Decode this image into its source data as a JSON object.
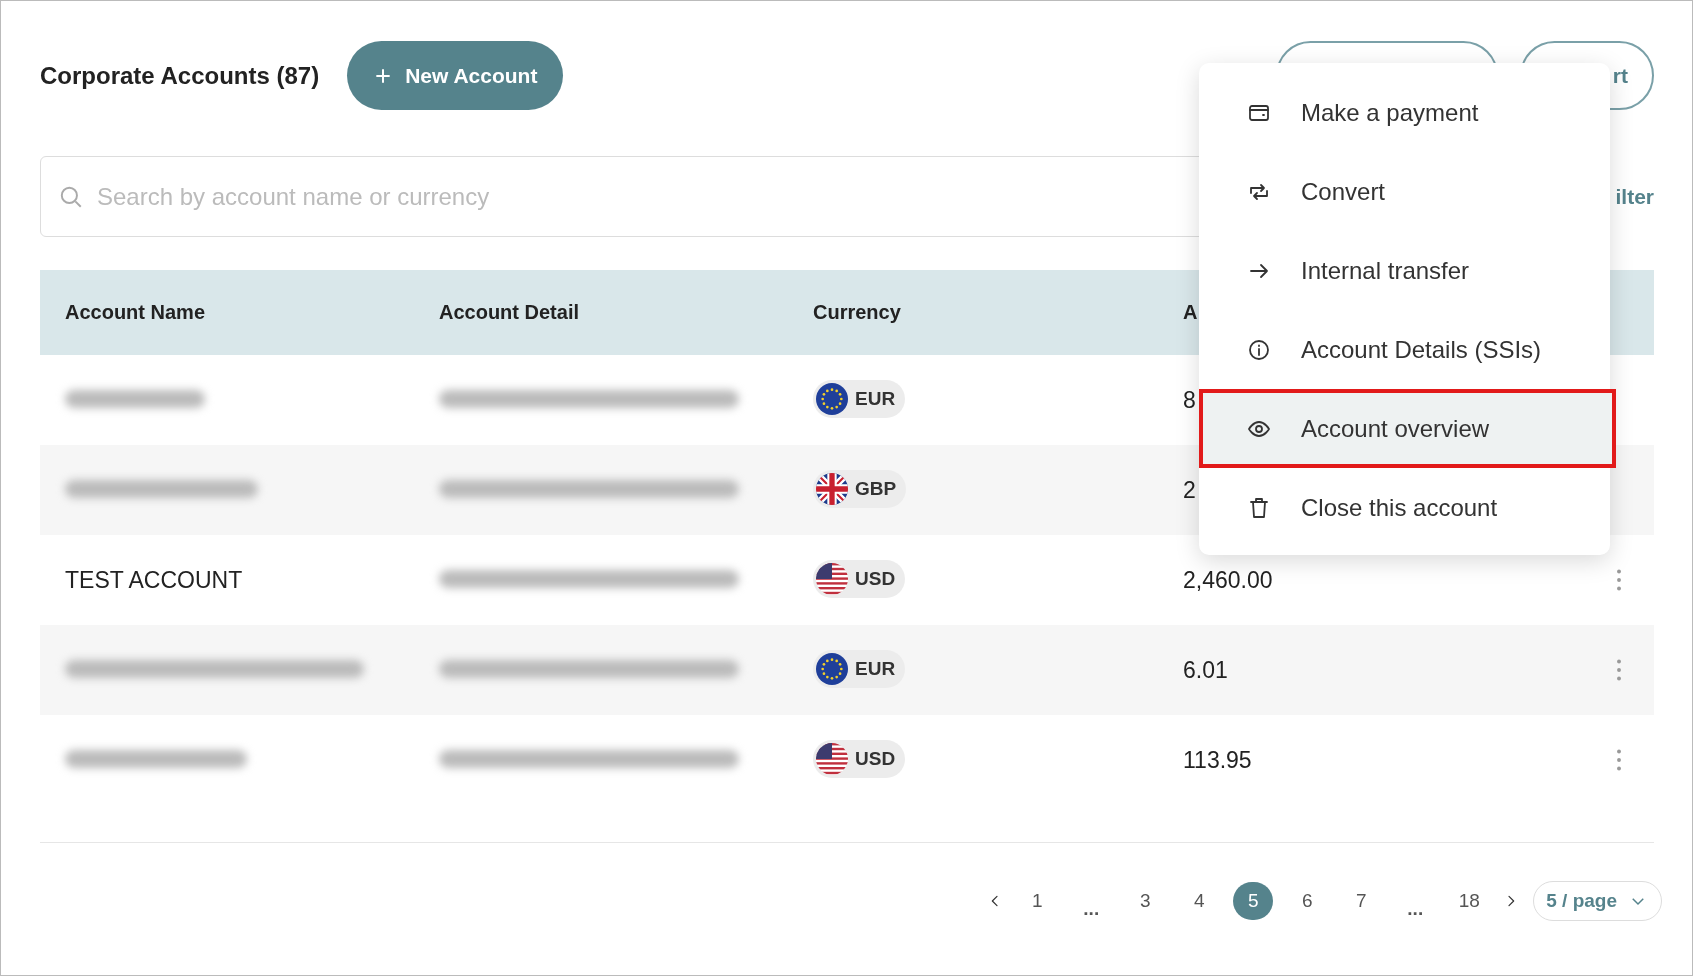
{
  "header": {
    "title": "Corporate Accounts (87)",
    "new_button": "New Account",
    "buttons": [
      {
        "kind": "blank"
      },
      {
        "kind": "text",
        "label": "rt"
      }
    ]
  },
  "search": {
    "placeholder": "Search by account name or currency",
    "filter_label": "ilter"
  },
  "table": {
    "columns": [
      "Account Name",
      "Account Detail",
      "Currency",
      "A"
    ],
    "rows": [
      {
        "name": {
          "redacted": true
        },
        "detail": {
          "redacted": true
        },
        "currency": {
          "kind": "eu",
          "code": "EUR"
        },
        "amount": "8",
        "actions": false
      },
      {
        "name": {
          "redacted": true
        },
        "detail": {
          "redacted": true
        },
        "currency": {
          "kind": "gb",
          "code": "GBP"
        },
        "amount": "2",
        "actions": false
      },
      {
        "name": {
          "redacted": false,
          "text": "TEST ACCOUNT"
        },
        "detail": {
          "redacted": true
        },
        "currency": {
          "kind": "us",
          "code": "USD"
        },
        "amount": "2,460.00",
        "actions": true
      },
      {
        "name": {
          "redacted": true
        },
        "detail": {
          "redacted": true
        },
        "currency": {
          "kind": "eu",
          "code": "EUR"
        },
        "amount": "6.01",
        "actions": true
      },
      {
        "name": {
          "redacted": true
        },
        "detail": {
          "redacted": true
        },
        "currency": {
          "kind": "us",
          "code": "USD"
        },
        "amount": "113.95",
        "actions": true
      }
    ]
  },
  "pagination": {
    "pages": [
      {
        "kind": "page",
        "label": "1",
        "selected": false
      },
      {
        "kind": "ellipsis",
        "label": "...",
        "selected": false
      },
      {
        "kind": "page",
        "label": "3",
        "selected": false
      },
      {
        "kind": "page",
        "label": "4",
        "selected": false
      },
      {
        "kind": "page",
        "label": "5",
        "selected": true
      },
      {
        "kind": "page",
        "label": "6",
        "selected": false
      },
      {
        "kind": "page",
        "label": "7",
        "selected": false
      },
      {
        "kind": "ellipsis",
        "label": "...",
        "selected": false
      },
      {
        "kind": "page",
        "label": "18",
        "selected": false
      }
    ],
    "page_size": "5 / page"
  },
  "context_menu": {
    "items": [
      {
        "kind": "wallet",
        "label": "Make a payment",
        "selected": false
      },
      {
        "kind": "convert",
        "label": "Convert",
        "selected": false
      },
      {
        "kind": "arrow",
        "label": "Internal transfer",
        "selected": false
      },
      {
        "kind": "info",
        "label": "Account Details (SSIs)",
        "selected": false
      },
      {
        "kind": "eye",
        "label": "Account overview",
        "selected": true
      },
      {
        "kind": "trash",
        "label": "Close this account",
        "selected": false
      }
    ]
  }
}
